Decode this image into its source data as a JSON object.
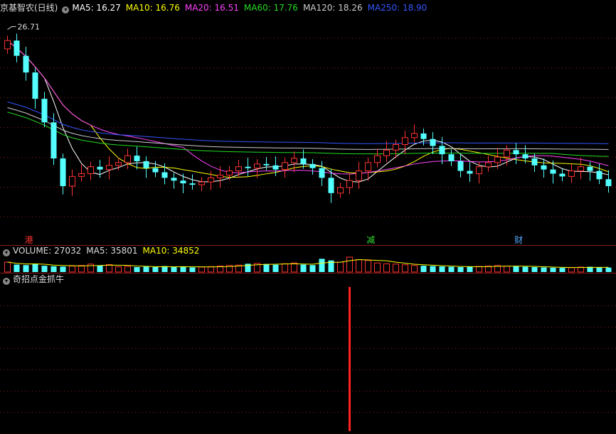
{
  "stock_title": "京基智农(日线)",
  "ma_labels": [
    {
      "text": "MA5: 16.27",
      "color": "#ffffff"
    },
    {
      "text": "MA10: 16.76",
      "color": "#ffff00"
    },
    {
      "text": "MA20: 16.51",
      "color": "#ff44ff"
    },
    {
      "text": "MA60: 17.76",
      "color": "#22dd22"
    },
    {
      "text": "MA120: 18.26",
      "color": "#cccccc"
    },
    {
      "text": "MA250: 18.90",
      "color": "#3355ff"
    }
  ],
  "high_label": "26.71",
  "events": [
    {
      "text": "港",
      "color": "#ff3333"
    },
    {
      "text": "减",
      "color": "#33dd33"
    },
    {
      "text": "财",
      "color": "#55aaff"
    }
  ],
  "volume_legend": [
    {
      "text": "VOLUME: 27032",
      "color": "#dddddd"
    },
    {
      "text": "MA5: 35801",
      "color": "#dddddd"
    },
    {
      "text": "MA10: 34852",
      "color": "#ffff00"
    }
  ],
  "indicator_title": "奇招点金抓牛",
  "colors": {
    "up": "#ff3333",
    "down": "#54ffff",
    "signal": "#ff2020",
    "grid": "#8b1a1a"
  },
  "chart_data": {
    "type": "candlestick",
    "price_range": [
      13.0,
      27.5
    ],
    "closes": [
      25.7,
      24.6,
      23.4,
      21.5,
      19.8,
      17.2,
      15.2,
      15.9,
      16.1,
      16.6,
      16.4,
      16.7,
      16.9,
      17.4,
      17.0,
      16.5,
      16.2,
      15.8,
      15.6,
      15.4,
      15.3,
      15.5,
      15.8,
      16.0,
      16.3,
      16.6,
      16.5,
      16.8,
      16.7,
      16.4,
      16.9,
      17.2,
      16.8,
      16.5,
      15.8,
      14.7,
      15.1,
      15.6,
      16.3,
      16.9,
      17.4,
      17.8,
      18.2,
      18.7,
      19.0,
      18.6,
      18.1,
      17.5,
      17.0,
      16.3,
      16.1,
      16.6,
      16.9,
      17.3,
      17.8,
      17.5,
      17.2,
      16.7,
      16.4,
      16.1,
      15.9,
      16.3,
      16.6,
      16.3,
      15.7,
      15.2
    ],
    "volumes": [
      60,
      45,
      42,
      50,
      38,
      35,
      33,
      36,
      40,
      48,
      40,
      45,
      32,
      35,
      30,
      33,
      30,
      36,
      30,
      34,
      28,
      30,
      33,
      36,
      40,
      42,
      50,
      52,
      48,
      44,
      50,
      55,
      45,
      42,
      80,
      70,
      60,
      90,
      75,
      70,
      55,
      50,
      48,
      44,
      40,
      38,
      36,
      34,
      32,
      30,
      32,
      34,
      36,
      40,
      36,
      34,
      32,
      30,
      28,
      26,
      25,
      27,
      30,
      32,
      28,
      27
    ],
    "signal_bar_index": 37
  }
}
